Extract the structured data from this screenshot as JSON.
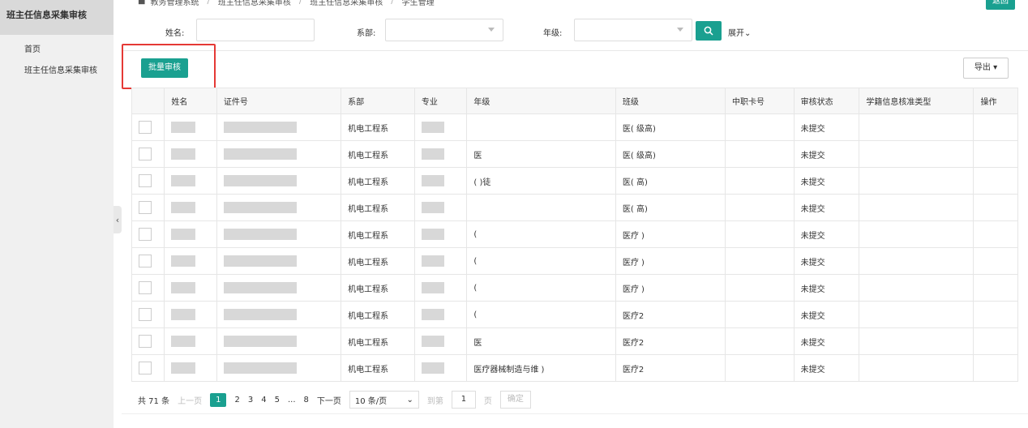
{
  "sidebar": {
    "title": "班主任信息采集审核",
    "items": [
      {
        "label": "首页"
      },
      {
        "label": "班主任信息采集审核"
      }
    ]
  },
  "breadcrumb": {
    "items": [
      "教务管理系统",
      "班主任信息采集审核",
      "班主任信息采集审核",
      "学生管理"
    ]
  },
  "header": {
    "back_label": "返回"
  },
  "search": {
    "name_label": "姓名:",
    "name_value": "",
    "dept_label": "系部:",
    "dept_value": "",
    "grade_label": "年级:",
    "grade_value": "",
    "expand_label": "展开⌄"
  },
  "toolbar": {
    "batch_review_label": "批量审核",
    "export_label": "导出 ▾"
  },
  "table": {
    "columns": [
      "",
      "姓名",
      "证件号",
      "系部",
      "专业",
      "年级",
      "班级",
      "中职卡号",
      "审核状态",
      "学籍信息核准类型",
      "操作"
    ],
    "rows": [
      {
        "dept": "机电工程系",
        "grade": "",
        "class": "医(    级高)",
        "status": "未提交"
      },
      {
        "dept": "机电工程系",
        "grade": "医",
        "class": "医(    级高)",
        "status": "未提交"
      },
      {
        "dept": "机电工程系",
        "grade": "(    )徒",
        "class": "医(    高)",
        "status": "未提交"
      },
      {
        "dept": "机电工程系",
        "grade": "",
        "class": "医(    高)",
        "status": "未提交"
      },
      {
        "dept": "机电工程系",
        "grade": "(",
        "class": "医疗    )",
        "status": "未提交"
      },
      {
        "dept": "机电工程系",
        "grade": "(",
        "class": "医疗    )",
        "status": "未提交"
      },
      {
        "dept": "机电工程系",
        "grade": "(",
        "class": "医疗    )",
        "status": "未提交"
      },
      {
        "dept": "机电工程系",
        "grade": "(",
        "class": "医疗2",
        "status": "未提交"
      },
      {
        "dept": "机电工程系",
        "grade": "医",
        "class": "医疗2",
        "status": "未提交"
      },
      {
        "dept": "机电工程系",
        "grade": "医疗器械制造与维    )",
        "class": "医疗2",
        "status": "未提交"
      }
    ]
  },
  "pagination": {
    "total": "共 71 条",
    "prev": "上一页",
    "pages": [
      "1",
      "2",
      "3",
      "4",
      "5",
      "...",
      "8"
    ],
    "next": "下一页",
    "page_size": "10 条/页",
    "goto_label": "到第",
    "goto_value": "1",
    "page_unit": "页",
    "confirm": "确定"
  },
  "colors": {
    "accent": "#1aa090",
    "highlight": "#e53935"
  }
}
